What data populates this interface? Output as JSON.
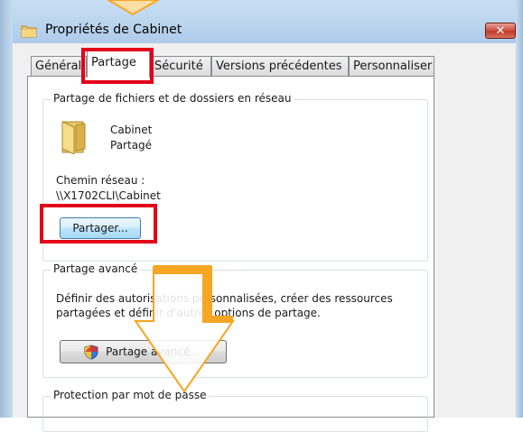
{
  "window": {
    "title": "Propriétés de Cabinet",
    "close_label": "✕"
  },
  "tabs": [
    {
      "label": "Général"
    },
    {
      "label": "Partage"
    },
    {
      "label": "Sécurité"
    },
    {
      "label": "Versions précédentes"
    },
    {
      "label": "Personnaliser"
    }
  ],
  "network_sharing": {
    "group_title": "Partage de fichiers et de dossiers en réseau",
    "folder_name": "Cabinet",
    "folder_status": "Partagé",
    "path_label": "Chemin réseau :",
    "path_value": "\\\\X1702CLI\\Cabinet",
    "share_button": "Partager..."
  },
  "advanced_sharing": {
    "group_title": "Partage avancé",
    "description_line1": "Définir des autorisations personnalisées, créer des ressources",
    "description_line2": "partagées et définir d'autres options de partage.",
    "button": "Partage avancé..."
  },
  "password_protection": {
    "group_title": "Protection par mot de passe"
  },
  "colors": {
    "highlight_red": "#e2001a",
    "annotation_orange": "#f5a623"
  }
}
